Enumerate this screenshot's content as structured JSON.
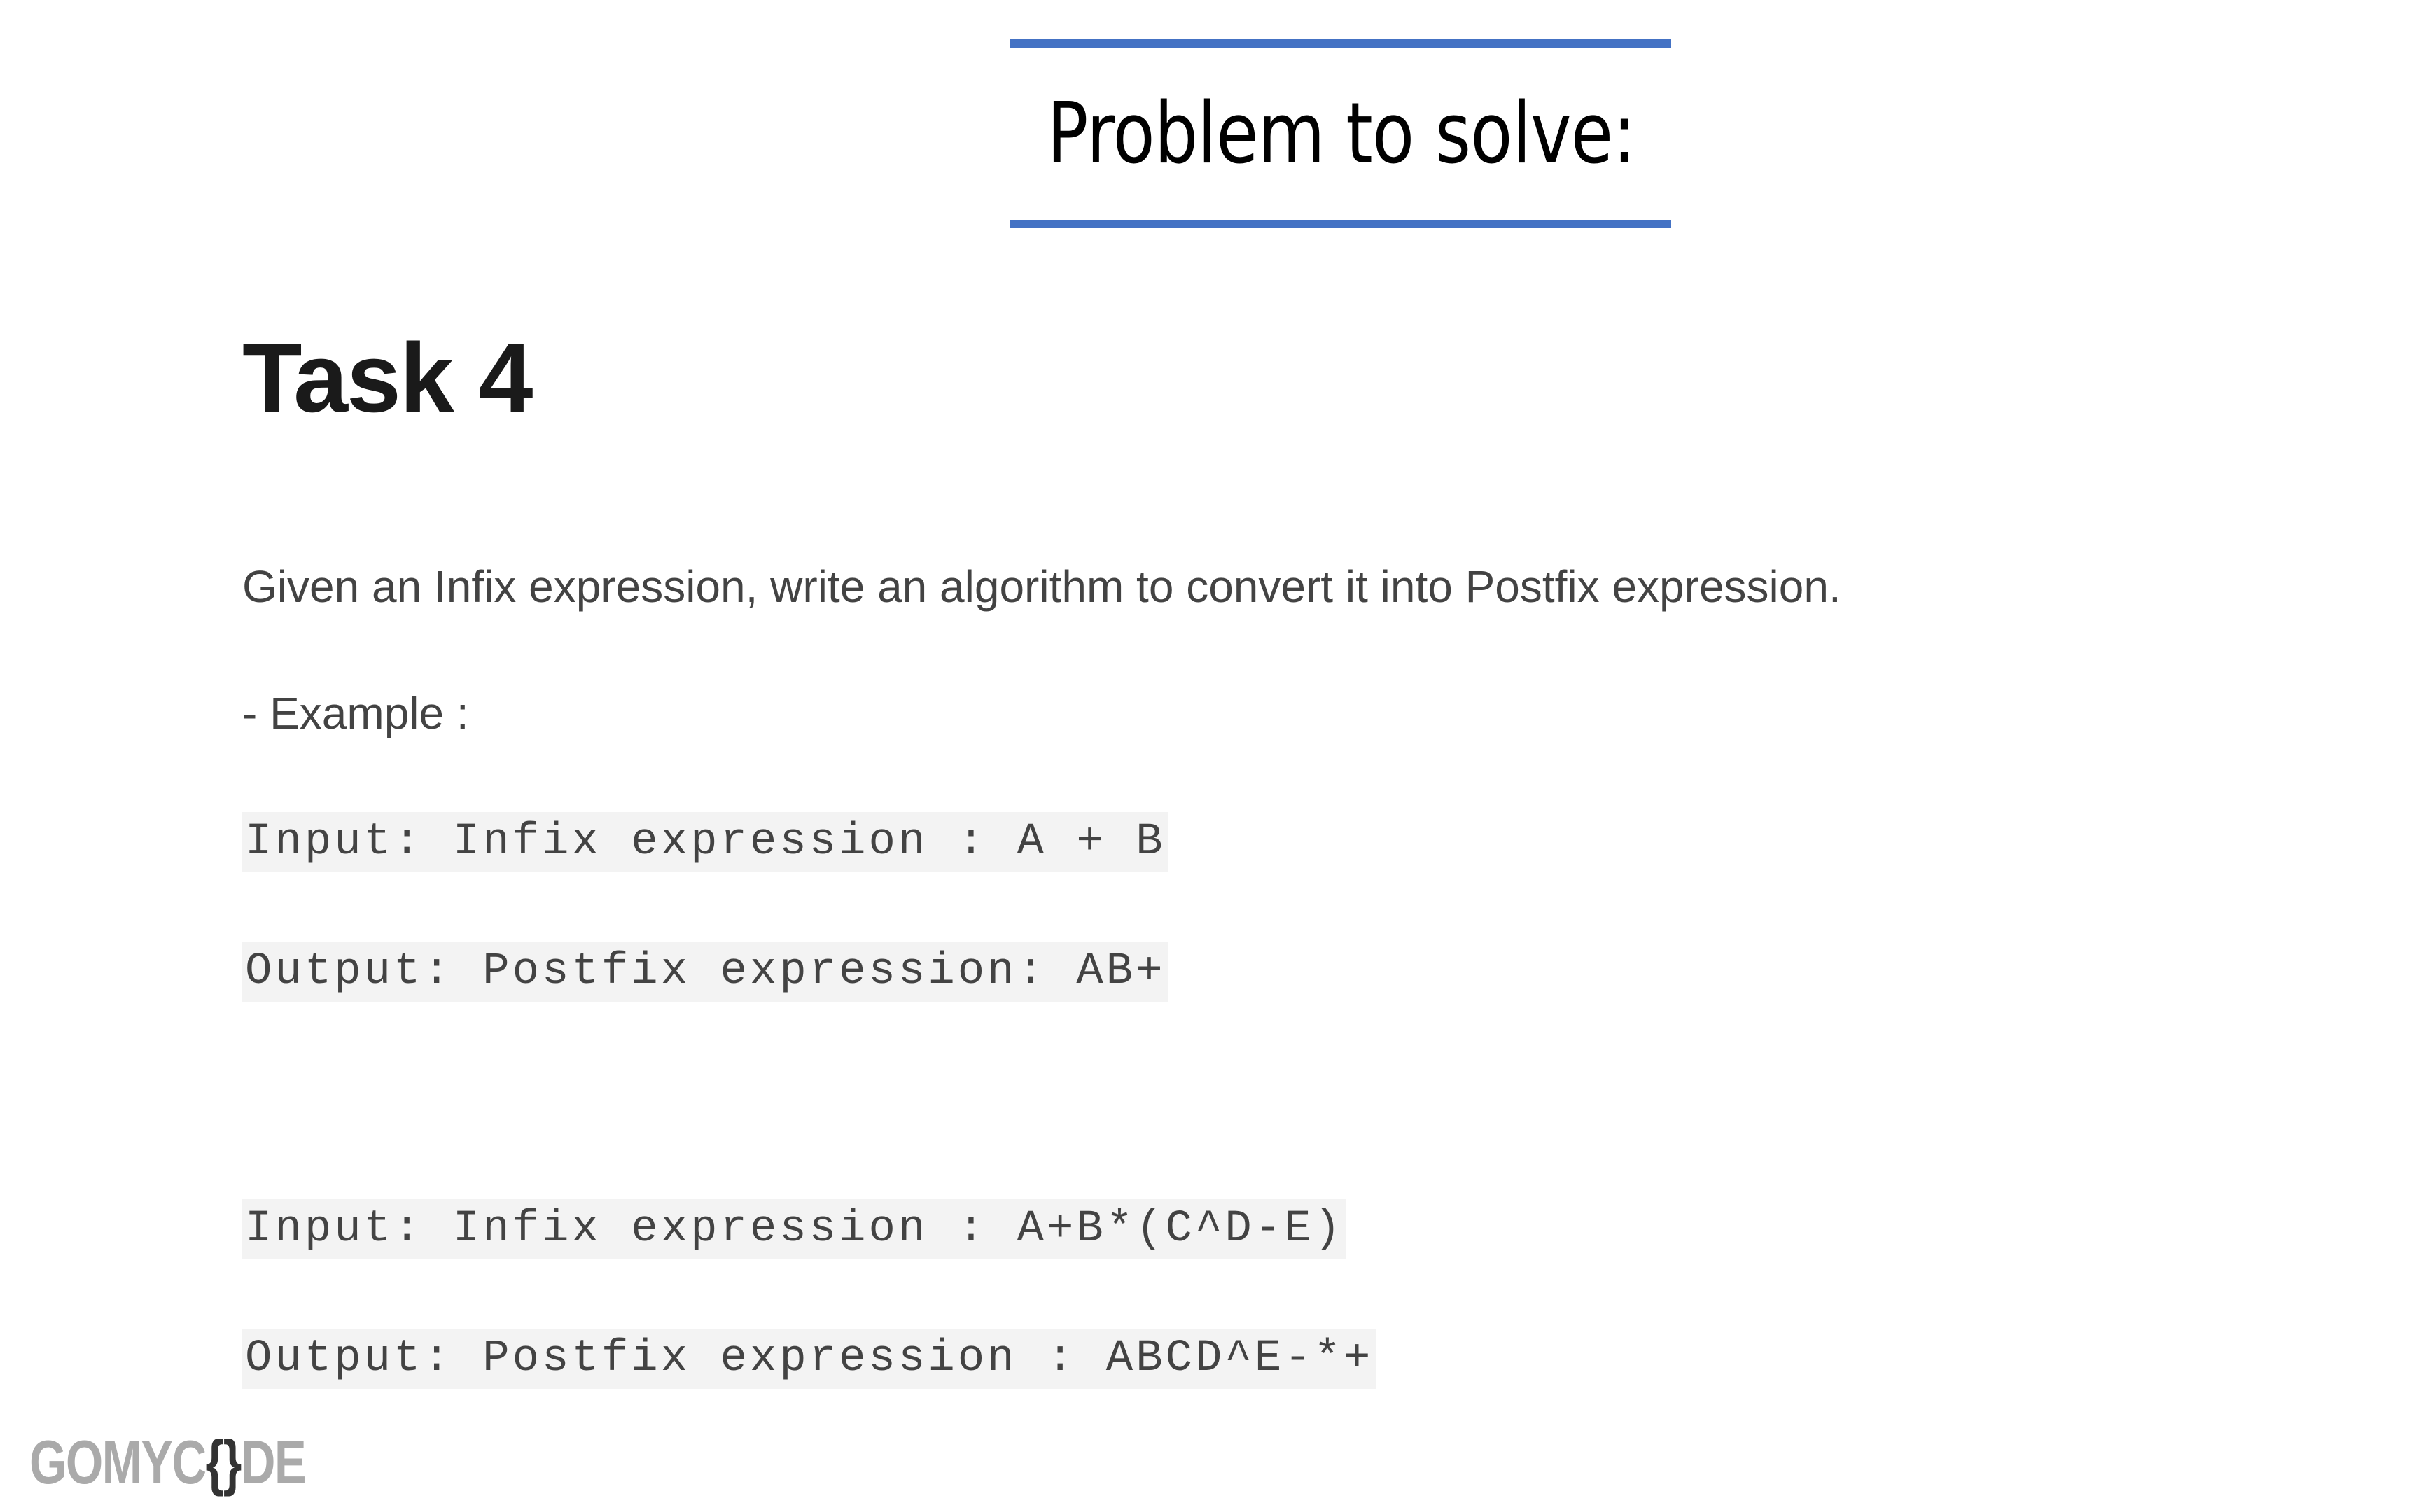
{
  "header": {
    "title": "Problem to solve:",
    "border_color": "#4472c4"
  },
  "task": {
    "title": "Task 4",
    "description": "Given an Infix expression, write an algorithm to convert it into Postfix expression.",
    "example_label": "- Example :"
  },
  "examples": [
    {
      "input": "Input: Infix expression : A + B",
      "output": "Output: Postfix expression: AB+"
    },
    {
      "input": "Input: Infix expression : A+B*(C^D-E)",
      "output": "Output: Postfix expression : ABCD^E-*+"
    }
  ],
  "logo": {
    "part1": "GOMYC",
    "brace": "{}",
    "part2": "DE"
  }
}
